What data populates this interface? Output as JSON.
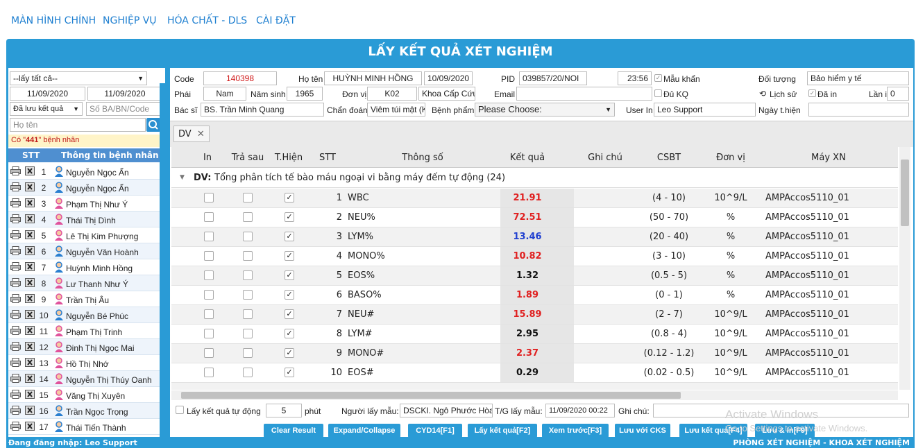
{
  "nav": [
    "MÀN HÌNH CHÍNH",
    "NGHIỆP VỤ",
    "HÓA CHẤT - DLS",
    "CÀI ĐẶT"
  ],
  "title": "LẤY KẾT QUẢ XÉT NGHIỆM",
  "left": {
    "filter": "--lấy tất cả--",
    "date_from": "11/09/2020",
    "date_to": "11/09/2020",
    "status_filter": "Đã lưu kết quả",
    "search_code_placeholder": "Số BA/BN/Code",
    "name_placeholder": "Họ tên",
    "count_prefix": "Có \"",
    "count_value": "441",
    "count_suffix": "\" bệnh nhân",
    "col_stt": "STT",
    "col_info": "Thông tin bệnh nhân",
    "patients": [
      {
        "no": "1",
        "name": "Nguyễn Ngọc Ẩn",
        "gender": "m"
      },
      {
        "no": "2",
        "name": "Nguyễn Ngọc Ẩn",
        "gender": "m"
      },
      {
        "no": "3",
        "name": "Phạm Thị Như Ý",
        "gender": "f"
      },
      {
        "no": "4",
        "name": "Thái Thị Dình",
        "gender": "f"
      },
      {
        "no": "5",
        "name": "Lê Thị Kim Phượng",
        "gender": "f"
      },
      {
        "no": "6",
        "name": "Nguyễn Văn Hoành",
        "gender": "m"
      },
      {
        "no": "7",
        "name": "Huỳnh Minh Hồng",
        "gender": "m"
      },
      {
        "no": "8",
        "name": "Lư Thanh Như Ý",
        "gender": "f"
      },
      {
        "no": "9",
        "name": "Trần Thị Âu",
        "gender": "f"
      },
      {
        "no": "10",
        "name": "Nguyễn Bé Phúc",
        "gender": "m"
      },
      {
        "no": "11",
        "name": "Phạm Thị Trinh",
        "gender": "f"
      },
      {
        "no": "12",
        "name": "Đinh Thị Ngọc Mai",
        "gender": "f"
      },
      {
        "no": "13",
        "name": "Hồ Thị Nhớ",
        "gender": "f"
      },
      {
        "no": "14",
        "name": "Nguyễn Thị Thúy Oanh",
        "gender": "f"
      },
      {
        "no": "15",
        "name": "Văng Thị Xuyên",
        "gender": "f"
      },
      {
        "no": "16",
        "name": "Trần Ngọc Trọng",
        "gender": "m"
      },
      {
        "no": "17",
        "name": "Thái Tiến Thành",
        "gender": "m"
      }
    ]
  },
  "form": {
    "code_label": "Code",
    "code": "140398",
    "name_label": "Họ tên",
    "name": "HUỲNH MINH HỒNG",
    "dob": "10/09/2020",
    "pid_label": "PID",
    "pid": "039857/20/NOI",
    "time": "23:56",
    "urgent_label": "Mẫu khẩn",
    "object_label": "Đối tượng",
    "object": "Bảo hiểm y tế",
    "gender_label": "Phái",
    "gender": "Nam",
    "birthyear_label": "Năm sinh",
    "birthyear": "1965",
    "unit_label": "Đơn vị",
    "unit_code": "K02",
    "unit_name": "Khoa Cấp Cứu",
    "email_label": "Email",
    "email": "",
    "full_label": "Đủ KQ",
    "history_label": "Lịch sử",
    "printed_label": "Đã in",
    "times_label": "Lần in",
    "times": "0",
    "doctor_label": "Bác sĩ",
    "doctor": "BS. Trần Minh Quang",
    "diagnosis_label": "Chẩn đoán",
    "diagnosis": "Viêm túi mật (K",
    "specimen_label": "Bệnh phẩm",
    "specimen": "Please Choose:",
    "user_label": "User In",
    "user": "Leo Support",
    "exec_label": "Ngày t.hiện",
    "exec": ""
  },
  "tab": "DV",
  "grid": {
    "headers": [
      "In",
      "Trả sau",
      "T.Hiện",
      "STT",
      "Thông số",
      "Kết quả",
      "Ghi chú",
      "CSBT",
      "Đơn vị",
      "Máy XN"
    ],
    "group_label": "DV:",
    "group_title": "Tổng phân tích tế bào máu ngoại vi bằng máy đếm tự động (24)",
    "rows": [
      {
        "stt": "1",
        "param": "WBC",
        "result": "21.91",
        "color": "#e02020",
        "ref": "(4 - 10)",
        "unit": "10^9/L",
        "machine": "AMPAccos5110_01"
      },
      {
        "stt": "2",
        "param": "NEU%",
        "result": "72.51",
        "color": "#e02020",
        "ref": "(50 - 70)",
        "unit": "%",
        "machine": "AMPAccos5110_01"
      },
      {
        "stt": "3",
        "param": "LYM%",
        "result": "13.46",
        "color": "#2040d0",
        "ref": "(20 - 40)",
        "unit": "%",
        "machine": "AMPAccos5110_01"
      },
      {
        "stt": "4",
        "param": "MONO%",
        "result": "10.82",
        "color": "#e02020",
        "ref": "(3 - 10)",
        "unit": "%",
        "machine": "AMPAccos5110_01"
      },
      {
        "stt": "5",
        "param": "EOS%",
        "result": "1.32",
        "color": "#111111",
        "ref": "(0.5 - 5)",
        "unit": "%",
        "machine": "AMPAccos5110_01"
      },
      {
        "stt": "6",
        "param": "BASO%",
        "result": "1.89",
        "color": "#e02020",
        "ref": "(0 - 1)",
        "unit": "%",
        "machine": "AMPAccos5110_01"
      },
      {
        "stt": "7",
        "param": "NEU#",
        "result": "15.89",
        "color": "#e02020",
        "ref": "(2 - 7)",
        "unit": "10^9/L",
        "machine": "AMPAccos5110_01"
      },
      {
        "stt": "8",
        "param": "LYM#",
        "result": "2.95",
        "color": "#111111",
        "ref": "(0.8 - 4)",
        "unit": "10^9/L",
        "machine": "AMPAccos5110_01"
      },
      {
        "stt": "9",
        "param": "MONO#",
        "result": "2.37",
        "color": "#e02020",
        "ref": "(0.12 - 1.2)",
        "unit": "10^9/L",
        "machine": "AMPAccos5110_01"
      },
      {
        "stt": "10",
        "param": "EOS#",
        "result": "0.29",
        "color": "#111111",
        "ref": "(0.02 - 0.5)",
        "unit": "10^9/L",
        "machine": "AMPAccos5110_01"
      }
    ]
  },
  "bottom": {
    "auto_label": "Lấy kết quả tự động",
    "auto_value": "5",
    "minutes": "phút",
    "collector_label": "Người lấy mẫu:",
    "collector": "DSCKI. Ngô Phước Hòa",
    "collect_time_label": "T/G lấy mẫu:",
    "collect_time": "11/09/2020 00:22",
    "note_label": "Ghi chú:"
  },
  "buttons": [
    "Clear Result",
    "Expand/Collapse",
    "CYD14[F1]",
    "Lấy kết quả[F2]",
    "Xem trước[F3]",
    "Lưu với CKS",
    "Lưu kết quả[F4]",
    "Lưu & In[F9]"
  ],
  "status": {
    "login": "Đang đăng nhập: Leo Support",
    "dept": "PHÒNG XÉT NGHIỆM - KHOA XÉT NGHIỆM"
  },
  "watermark": {
    "line1": "Activate Windows",
    "line2": "Go to Settings to activate Windows."
  },
  "colors": {
    "accent": "#2a9bd6",
    "code": "#d01818"
  }
}
